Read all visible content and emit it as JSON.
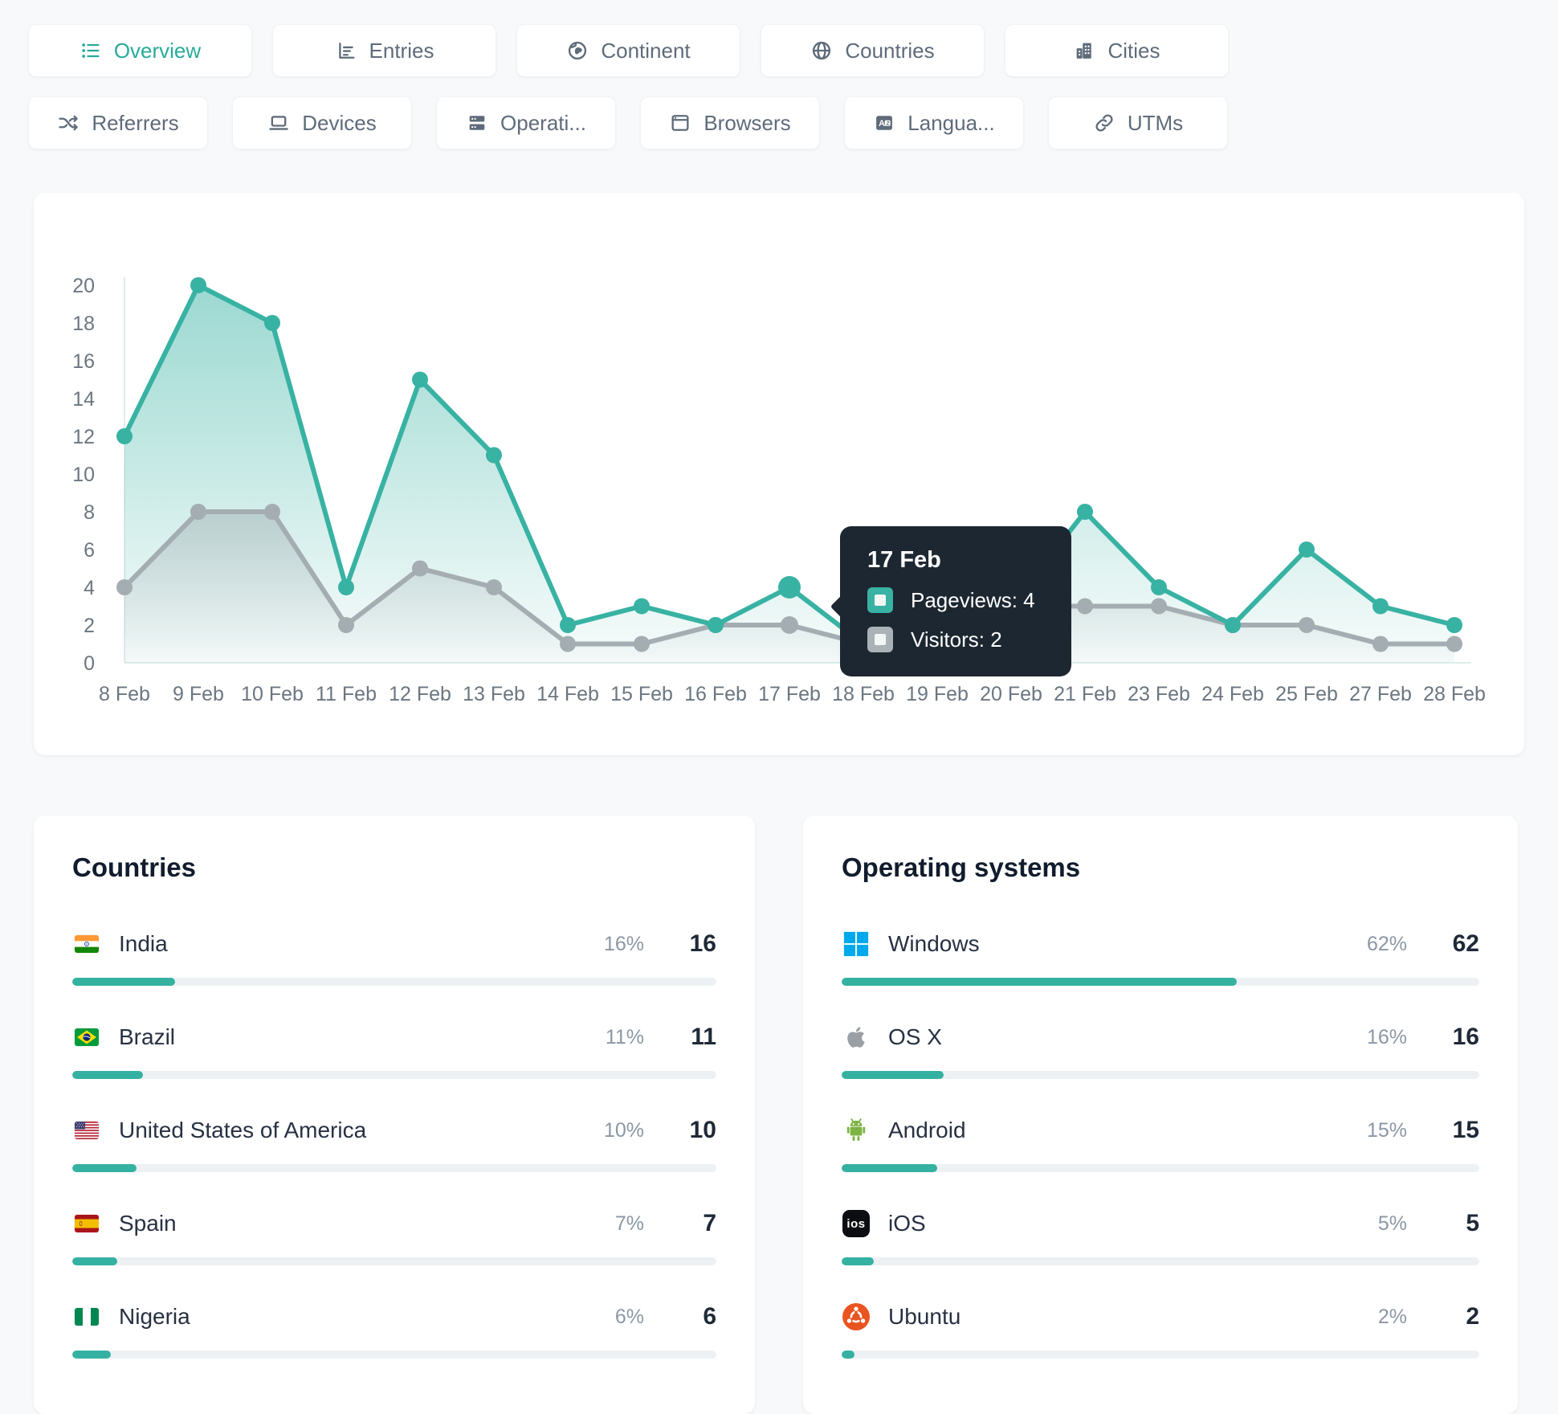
{
  "accent_color": "#35b1a2",
  "tabs_row1": [
    {
      "label": "Overview",
      "icon": "list",
      "active": true
    },
    {
      "label": "Entries",
      "icon": "entries",
      "active": false
    },
    {
      "label": "Continent",
      "icon": "earth",
      "active": false
    },
    {
      "label": "Countries",
      "icon": "globe",
      "active": false
    },
    {
      "label": "Cities",
      "icon": "buildings",
      "active": false
    }
  ],
  "tabs_row2": [
    {
      "label": "Referrers",
      "icon": "shuffle",
      "active": false
    },
    {
      "label": "Devices",
      "icon": "laptop",
      "active": false
    },
    {
      "label": "Operati...",
      "icon": "server",
      "active": false
    },
    {
      "label": "Browsers",
      "icon": "browser",
      "active": false
    },
    {
      "label": "Langua...",
      "icon": "translate",
      "active": false
    },
    {
      "label": "UTMs",
      "icon": "link",
      "active": false
    }
  ],
  "chart_data": {
    "type": "line",
    "title": "",
    "xlabel": "",
    "ylabel": "",
    "ylim": [
      0,
      20
    ],
    "y_ticks": [
      0,
      2,
      4,
      6,
      8,
      10,
      12,
      14,
      16,
      18,
      20
    ],
    "grid": false,
    "categories": [
      "8 Feb",
      "9 Feb",
      "10 Feb",
      "11 Feb",
      "12 Feb",
      "13 Feb",
      "14 Feb",
      "15 Feb",
      "16 Feb",
      "17 Feb",
      "18 Feb",
      "19 Feb",
      "20 Feb",
      "21 Feb",
      "23 Feb",
      "24 Feb",
      "25 Feb",
      "27 Feb",
      "28 Feb"
    ],
    "series": [
      {
        "name": "Pageviews",
        "color": "#38b2a3",
        "values": [
          12,
          20,
          18,
          4,
          15,
          11,
          2,
          3,
          2,
          4,
          1,
          2,
          3,
          8,
          4,
          2,
          6,
          3,
          2
        ]
      },
      {
        "name": "Visitors",
        "color": "#a4adb2",
        "values": [
          4,
          8,
          8,
          2,
          5,
          4,
          1,
          1,
          2,
          2,
          1,
          1,
          3,
          3,
          3,
          2,
          2,
          1,
          1
        ]
      }
    ],
    "hover_index": 9,
    "tooltip": {
      "title": "17 Feb",
      "rows": [
        {
          "label": "Pageviews: 4",
          "color": "#38b2a3"
        },
        {
          "label": "Visitors: 2",
          "color": "#aab2b7"
        }
      ]
    }
  },
  "countries_panel": {
    "title": "Countries",
    "rows": [
      {
        "name": "India",
        "flag": "india",
        "percent_label": "16%",
        "percent": 16,
        "count": "16"
      },
      {
        "name": "Brazil",
        "flag": "brazil",
        "percent_label": "11%",
        "percent": 11,
        "count": "11"
      },
      {
        "name": "United States of America",
        "flag": "usa",
        "percent_label": "10%",
        "percent": 10,
        "count": "10"
      },
      {
        "name": "Spain",
        "flag": "spain",
        "percent_label": "7%",
        "percent": 7,
        "count": "7"
      },
      {
        "name": "Nigeria",
        "flag": "nigeria",
        "percent_label": "6%",
        "percent": 6,
        "count": "6"
      }
    ]
  },
  "os_panel": {
    "title": "Operating systems",
    "rows": [
      {
        "name": "Windows",
        "icon": "windows",
        "percent_label": "62%",
        "percent": 62,
        "count": "62"
      },
      {
        "name": "OS X",
        "icon": "apple",
        "percent_label": "16%",
        "percent": 16,
        "count": "16"
      },
      {
        "name": "Android",
        "icon": "android",
        "percent_label": "15%",
        "percent": 15,
        "count": "15"
      },
      {
        "name": "iOS",
        "icon": "ios",
        "icon_text": "ios",
        "percent_label": "5%",
        "percent": 5,
        "count": "5"
      },
      {
        "name": "Ubuntu",
        "icon": "ubuntu",
        "percent_label": "2%",
        "percent": 2,
        "count": "2"
      }
    ]
  }
}
